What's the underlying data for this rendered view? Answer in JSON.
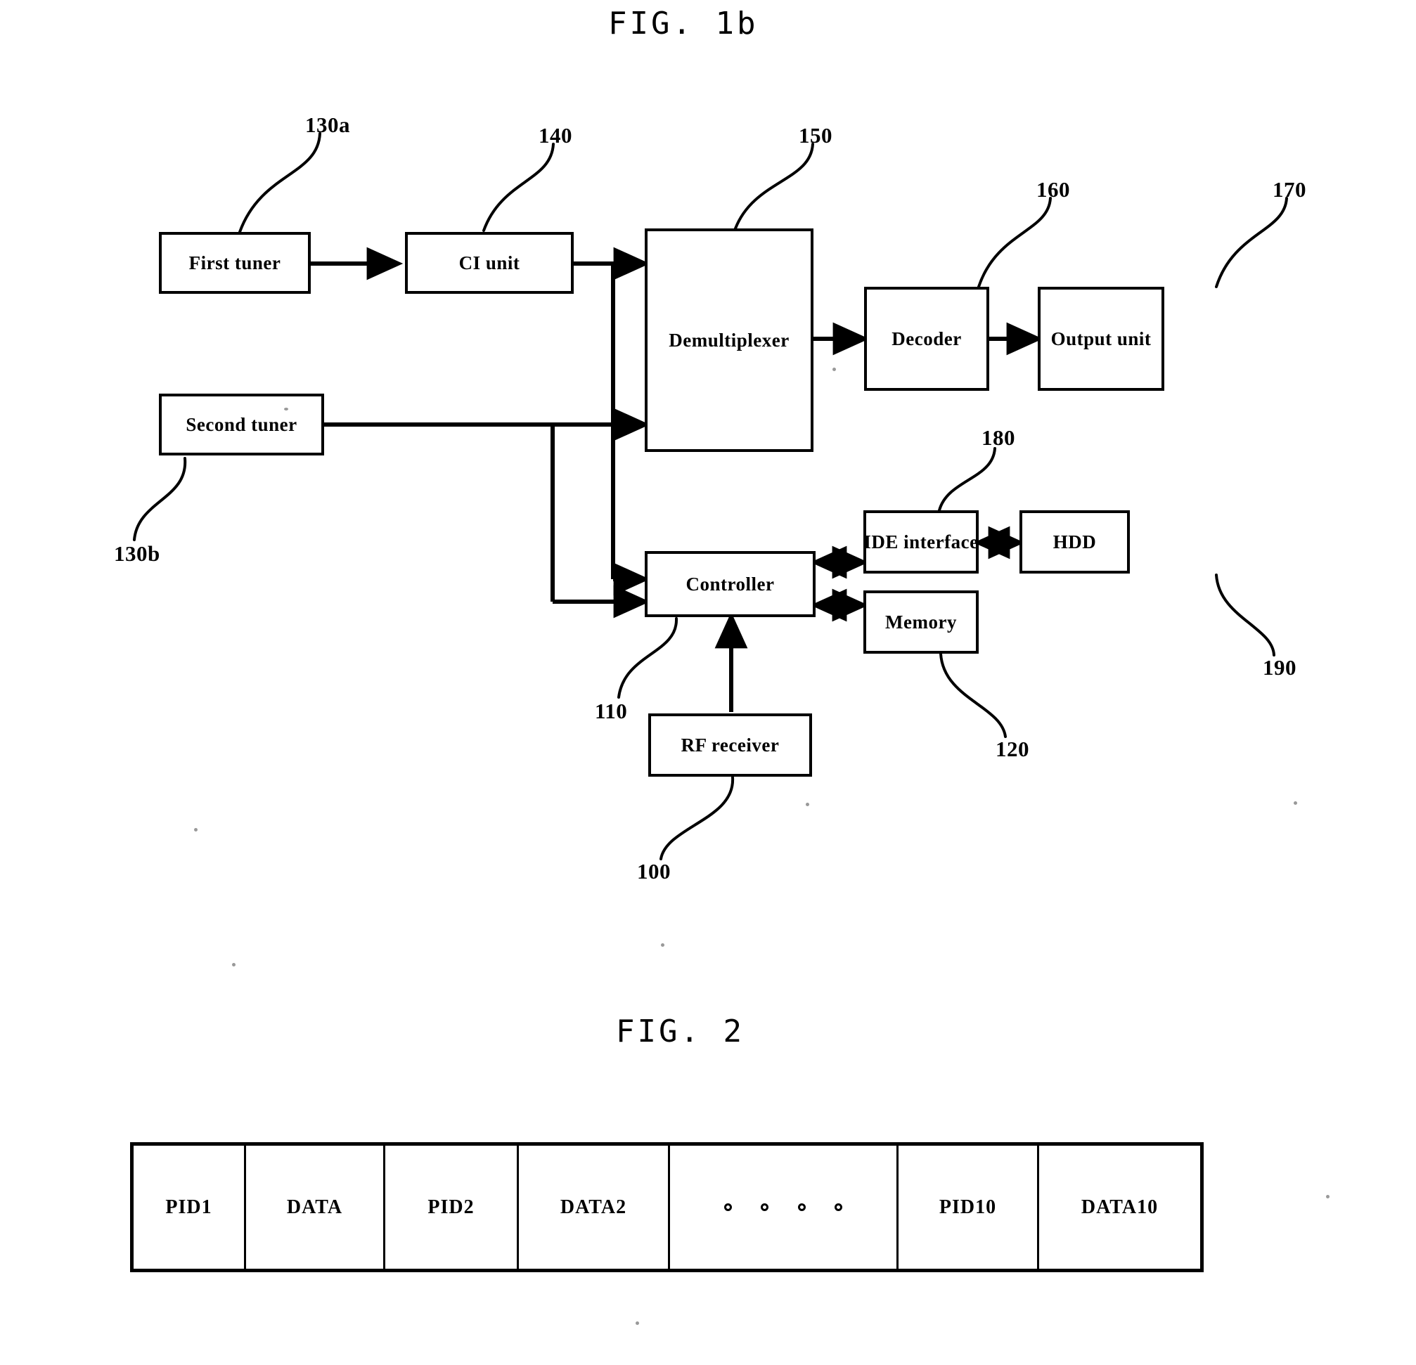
{
  "figures": [
    {
      "id": "fig1b",
      "title": "FIG. 1b"
    },
    {
      "id": "fig2",
      "title": "FIG. 2"
    }
  ],
  "fig1b": {
    "title": "FIG. 1b",
    "blocks": [
      {
        "key": "first_tuner",
        "label": "First tuner",
        "ref": "130a"
      },
      {
        "key": "ci_unit",
        "label": "CI unit",
        "ref": "140"
      },
      {
        "key": "demultiplexer",
        "label": "Demultiplexer",
        "ref": "150"
      },
      {
        "key": "decoder",
        "label": "Decoder",
        "ref": "160"
      },
      {
        "key": "output_unit",
        "label": "Output unit",
        "ref": "170"
      },
      {
        "key": "second_tuner",
        "label": "Second tuner",
        "ref": "130b"
      },
      {
        "key": "controller",
        "label": "Controller",
        "ref": "110"
      },
      {
        "key": "ide_interface",
        "label": "IDE interface",
        "ref": "180"
      },
      {
        "key": "hdd",
        "label": "HDD",
        "ref": "190"
      },
      {
        "key": "memory",
        "label": "Memory",
        "ref": "120"
      },
      {
        "key": "rf_receiver",
        "label": "RF receiver",
        "ref": "100"
      }
    ],
    "labels": {
      "first_tuner": "First tuner",
      "ci_unit": "CI unit",
      "demultiplexer": "Demultiplexer",
      "decoder": "Decoder",
      "output_unit": "Output unit",
      "second_tuner": "Second tuner",
      "controller": "Controller",
      "ide_interface": "IDE interface",
      "hdd": "HDD",
      "memory": "Memory",
      "rf_receiver": "RF receiver"
    },
    "refs": {
      "first_tuner": "130a",
      "ci_unit": "140",
      "demultiplexer": "150",
      "decoder": "160",
      "output_unit": "170",
      "second_tuner": "130b",
      "controller": "110",
      "ide_interface": "180",
      "hdd": "190",
      "memory": "120",
      "rf_receiver": "100"
    },
    "connections": [
      {
        "from": "first_tuner",
        "to": "ci_unit",
        "style": "arrow"
      },
      {
        "from": "ci_unit",
        "to": "demultiplexer",
        "style": "arrow"
      },
      {
        "from": "ci_unit",
        "to": "controller",
        "style": "arrow"
      },
      {
        "from": "second_tuner",
        "to": "demultiplexer",
        "style": "arrow"
      },
      {
        "from": "second_tuner",
        "to": "controller",
        "style": "arrow"
      },
      {
        "from": "demultiplexer",
        "to": "decoder",
        "style": "arrow"
      },
      {
        "from": "decoder",
        "to": "output_unit",
        "style": "arrow"
      },
      {
        "from": "controller",
        "to": "ide_interface",
        "style": "double-arrow"
      },
      {
        "from": "controller",
        "to": "memory",
        "style": "double-arrow"
      },
      {
        "from": "ide_interface",
        "to": "hdd",
        "style": "double-arrow"
      },
      {
        "from": "rf_receiver",
        "to": "controller",
        "style": "arrow"
      }
    ]
  },
  "fig2": {
    "title": "FIG. 2",
    "frame_cells": [
      {
        "label": "PID1",
        "type": "text"
      },
      {
        "label": "DATA",
        "type": "text"
      },
      {
        "label": "PID2",
        "type": "text"
      },
      {
        "label": "DATA2",
        "type": "text"
      },
      {
        "label": "",
        "type": "ellipsis",
        "dot_count": 4
      },
      {
        "label": "PID10",
        "type": "text"
      },
      {
        "label": "DATA10",
        "type": "text"
      }
    ]
  },
  "colors": {
    "ink": "#000000",
    "paper": "#ffffff"
  }
}
